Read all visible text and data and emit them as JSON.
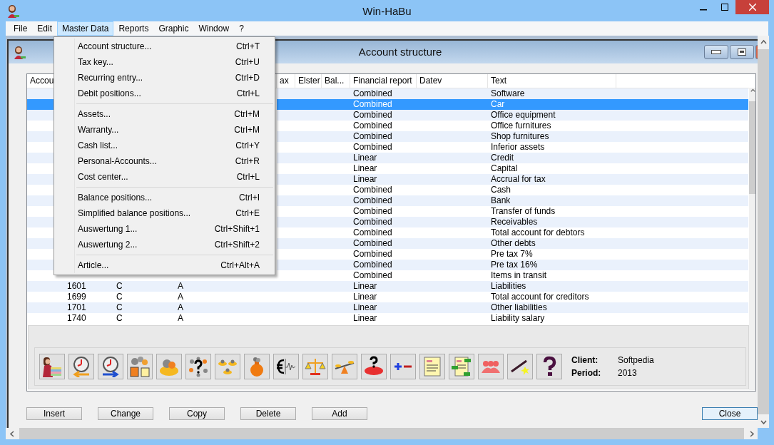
{
  "window": {
    "title": "Win-HaBu"
  },
  "menu_bar": [
    {
      "label": "File",
      "selected": false
    },
    {
      "label": "Edit",
      "selected": false
    },
    {
      "label": "Master Data",
      "selected": true
    },
    {
      "label": "Reports",
      "selected": false
    },
    {
      "label": "Graphic",
      "selected": false
    },
    {
      "label": "Window",
      "selected": false
    },
    {
      "label": "?",
      "selected": false
    }
  ],
  "dropdown_menu": [
    {
      "kind": "item",
      "label": "Account structure...",
      "shortcut": "Ctrl+T"
    },
    {
      "kind": "item",
      "label": "Tax key...",
      "shortcut": "Ctrl+U"
    },
    {
      "kind": "item",
      "label": "Recurring entry...",
      "shortcut": "Ctrl+D"
    },
    {
      "kind": "item",
      "label": "Debit positions...",
      "shortcut": "Ctrl+L"
    },
    {
      "kind": "separator"
    },
    {
      "kind": "item",
      "label": "Assets...",
      "shortcut": "Ctrl+M"
    },
    {
      "kind": "item",
      "label": "Warranty...",
      "shortcut": "Ctrl+M"
    },
    {
      "kind": "item",
      "label": "Cash list...",
      "shortcut": "Ctrl+Y"
    },
    {
      "kind": "item",
      "label": "Personal-Accounts...",
      "shortcut": "Ctrl+R"
    },
    {
      "kind": "item",
      "label": "Cost center...",
      "shortcut": "Ctrl+L"
    },
    {
      "kind": "separator"
    },
    {
      "kind": "item",
      "label": "Balance positions...",
      "shortcut": "Ctrl+I"
    },
    {
      "kind": "item",
      "label": "Simplified balance positions...",
      "shortcut": "Ctrl+E"
    },
    {
      "kind": "item",
      "label": "Auswertung 1...",
      "shortcut": "Ctrl+Shift+1"
    },
    {
      "kind": "item",
      "label": "Auswertung 2...",
      "shortcut": "Ctrl+Shift+2"
    },
    {
      "kind": "separator"
    },
    {
      "kind": "item",
      "label": "Article...",
      "shortcut": "Ctrl+Alt+A"
    }
  ],
  "child_window": {
    "title": "Account structure"
  },
  "table": {
    "columns": [
      "Accou",
      "ax",
      "Elster",
      "Bal...",
      "Financial report",
      "Datev",
      "Text"
    ],
    "rows": [
      {
        "financial_report": "Combined",
        "text": "Software",
        "selected": false
      },
      {
        "financial_report": "Combined",
        "text": "Car",
        "selected": true
      },
      {
        "financial_report": "Combined",
        "text": "Office equipment",
        "selected": false
      },
      {
        "financial_report": "Combined",
        "text": "Office furnitures",
        "selected": false
      },
      {
        "financial_report": "Combined",
        "text": "Shop furnitures",
        "selected": false
      },
      {
        "financial_report": "Combined",
        "text": "Inferior assets",
        "selected": false
      },
      {
        "financial_report": "Linear",
        "text": "Credit",
        "selected": false
      },
      {
        "financial_report": "Linear",
        "text": "Capital",
        "selected": false
      },
      {
        "financial_report": "Linear",
        "text": "Accrual for tax",
        "selected": false
      },
      {
        "financial_report": "Combined",
        "text": "Cash",
        "selected": false
      },
      {
        "financial_report": "Combined",
        "text": "Bank",
        "selected": false
      },
      {
        "financial_report": "Combined",
        "text": "Transfer of funds",
        "selected": false
      },
      {
        "financial_report": "Combined",
        "text": "Receivables",
        "selected": false
      },
      {
        "financial_report": "Combined",
        "text": "Total account for debtors",
        "selected": false
      },
      {
        "financial_report": "Combined",
        "text": "Other debts",
        "selected": false
      },
      {
        "financial_report": "Combined",
        "text": "Pre tax 7%",
        "selected": false
      },
      {
        "financial_report": "Combined",
        "text": "Pre tax 16%",
        "selected": false
      },
      {
        "financial_report": "Combined",
        "text": "Items in transit",
        "selected": false
      },
      {
        "column_1": "1601",
        "column_2": "C",
        "column_3": "A",
        "financial_report": "Linear",
        "text": "Liabilities",
        "selected": false
      },
      {
        "column_1": "1699",
        "column_2": "C",
        "column_3": "A",
        "financial_report": "Linear",
        "text": "Total account for creditors",
        "selected": false
      },
      {
        "column_1": "1701",
        "column_2": "C",
        "column_3": "A",
        "financial_report": "Linear",
        "text": "Other liabilities",
        "selected": false
      },
      {
        "column_1": "1740",
        "column_2": "C",
        "column_3": "A",
        "financial_report": "Linear",
        "text": "Liability salary",
        "selected": false
      }
    ]
  },
  "toolbar": {
    "client_label": "Client:",
    "client": "Softpedia",
    "period_label": "Period:",
    "period": "2013"
  },
  "buttons": [
    {
      "label": "Insert",
      "focused": false
    },
    {
      "label": "Change",
      "focused": false
    },
    {
      "label": "Copy",
      "focused": false
    },
    {
      "label": "Delete",
      "focused": false
    },
    {
      "label": "Add",
      "focused": false
    },
    {
      "label": "Close",
      "focused": true
    }
  ]
}
